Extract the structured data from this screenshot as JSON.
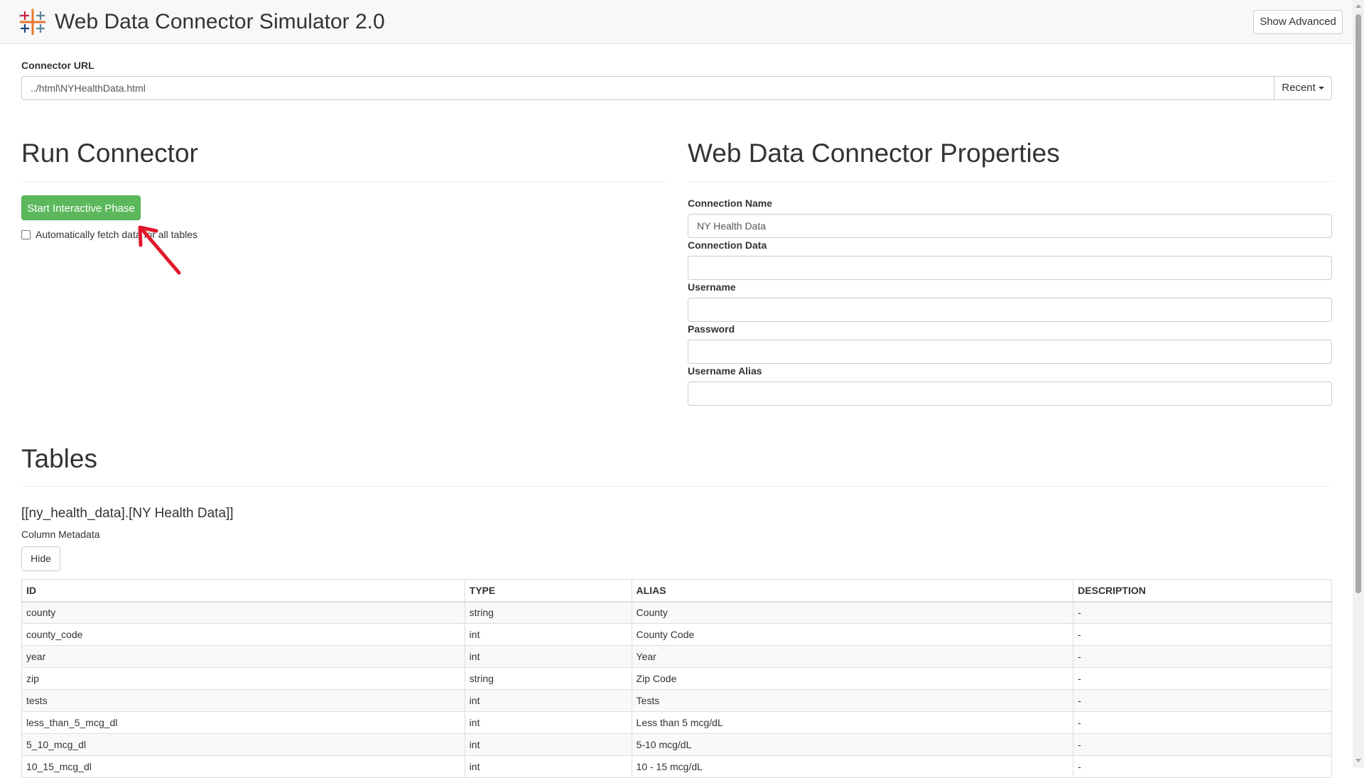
{
  "header": {
    "title": "Web Data Connector Simulator 2.0",
    "show_advanced_label": "Show Advanced",
    "logo_icon": "tableau-logo-icon"
  },
  "connector": {
    "url_label": "Connector URL",
    "url_value": "../html\\NYHealthData.html",
    "recent_label": "Recent"
  },
  "run": {
    "heading": "Run Connector",
    "start_label": "Start Interactive Phase",
    "auto_fetch_label": "Automatically fetch data for all tables",
    "auto_fetch_checked": false,
    "start_color": "#5cb85c",
    "annotation_icon": "red-arrow-icon",
    "annotation_color": "#e0162b"
  },
  "properties": {
    "heading": "Web Data Connector Properties",
    "fields": [
      {
        "label": "Connection Name",
        "value": "NY Health Data"
      },
      {
        "label": "Connection Data",
        "value": ""
      },
      {
        "label": "Username",
        "value": ""
      },
      {
        "label": "Password",
        "value": ""
      },
      {
        "label": "Username Alias",
        "value": ""
      }
    ]
  },
  "tables": {
    "heading": "Tables",
    "table_name": "[[ny_health_data].[NY Health Data]]",
    "column_metadata_label": "Column Metadata",
    "hide_label": "Hide",
    "columns": [
      "ID",
      "TYPE",
      "ALIAS",
      "DESCRIPTION"
    ],
    "rows": [
      [
        "county",
        "string",
        "County",
        "-"
      ],
      [
        "county_code",
        "int",
        "County Code",
        "-"
      ],
      [
        "year",
        "int",
        "Year",
        "-"
      ],
      [
        "zip",
        "string",
        "Zip Code",
        "-"
      ],
      [
        "tests",
        "int",
        "Tests",
        "-"
      ],
      [
        "less_than_5_mcg_dl",
        "int",
        "Less than 5 mcg/dL",
        "-"
      ],
      [
        "5_10_mcg_dl",
        "int",
        "5-10 mcg/dL",
        "-"
      ],
      [
        "10_15_mcg_dl",
        "int",
        "10 - 15 mcg/dL",
        "-"
      ]
    ]
  }
}
